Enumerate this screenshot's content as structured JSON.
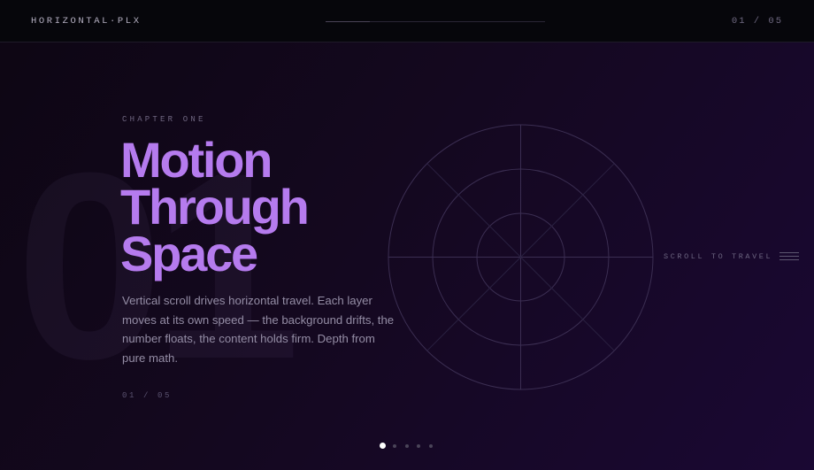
{
  "header": {
    "brand": "HORIZONTAL·PLX",
    "counter": "01 / 05",
    "progress": 0.2
  },
  "slide": {
    "big_number": "01",
    "eyebrow": "CHAPTER ONE",
    "headline": [
      "Motion",
      "Through",
      "Space"
    ],
    "body": "Vertical scroll drives horizontal travel. Each layer moves at its own speed — the background drifts, the number floats, the content holds firm. Depth from pure math.",
    "counter": "01 / 05"
  },
  "scroll_hint": {
    "label": "SCROLL TO TRAVEL",
    "icon": "menu-lines-icon"
  },
  "pagination": {
    "total": 5,
    "active": 0
  },
  "colors": {
    "accent": "#b57bee",
    "background": "#14081f",
    "topbar": "#06060b"
  }
}
